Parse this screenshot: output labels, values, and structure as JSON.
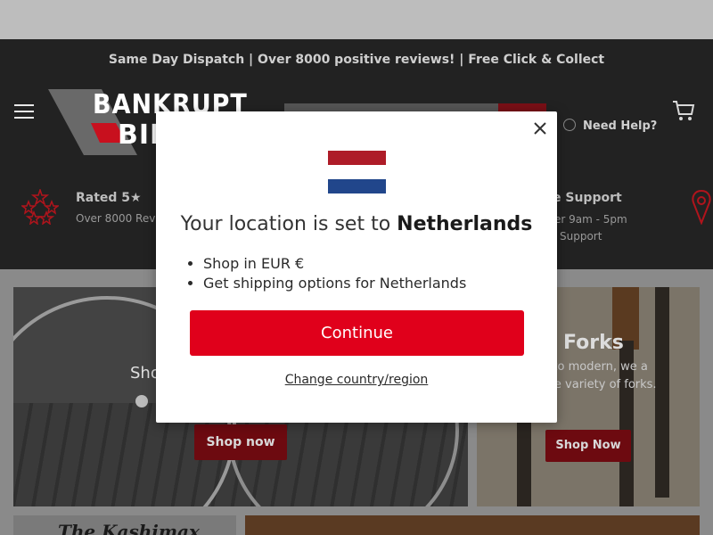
{
  "announcement": "Same Day Dispatch | Over 8000 positive reviews! | Free Click & Collect",
  "logo": {
    "line1": "BANKRUPT",
    "line2": "BIKES"
  },
  "header": {
    "help_label": "Need Help?"
  },
  "usp_left": {
    "title": "Rated 5★",
    "subtitle": "Over 8000 Rev"
  },
  "usp_right": {
    "title": "e Support",
    "line1": "er 9am - 5pm",
    "line2": "Support"
  },
  "tiles": {
    "wheels_title": "Sho",
    "wheels_button": "Shop now",
    "forks_title": "Forks",
    "forks_desc": "c to modern, we a wide variety of forks.",
    "forks_button": "Shop Now",
    "bottom_left_text": "The Kashimax"
  },
  "modal": {
    "heading_prefix": "Your location is set to ",
    "country": "Netherlands",
    "bullets": [
      "Shop in EUR €",
      "Get shipping options for Netherlands"
    ],
    "continue_label": "Continue",
    "change_label": "Change country/region",
    "flag_colors": [
      "#ae1c28",
      "#ffffff",
      "#21468b"
    ],
    "accent": "#e0001b"
  }
}
